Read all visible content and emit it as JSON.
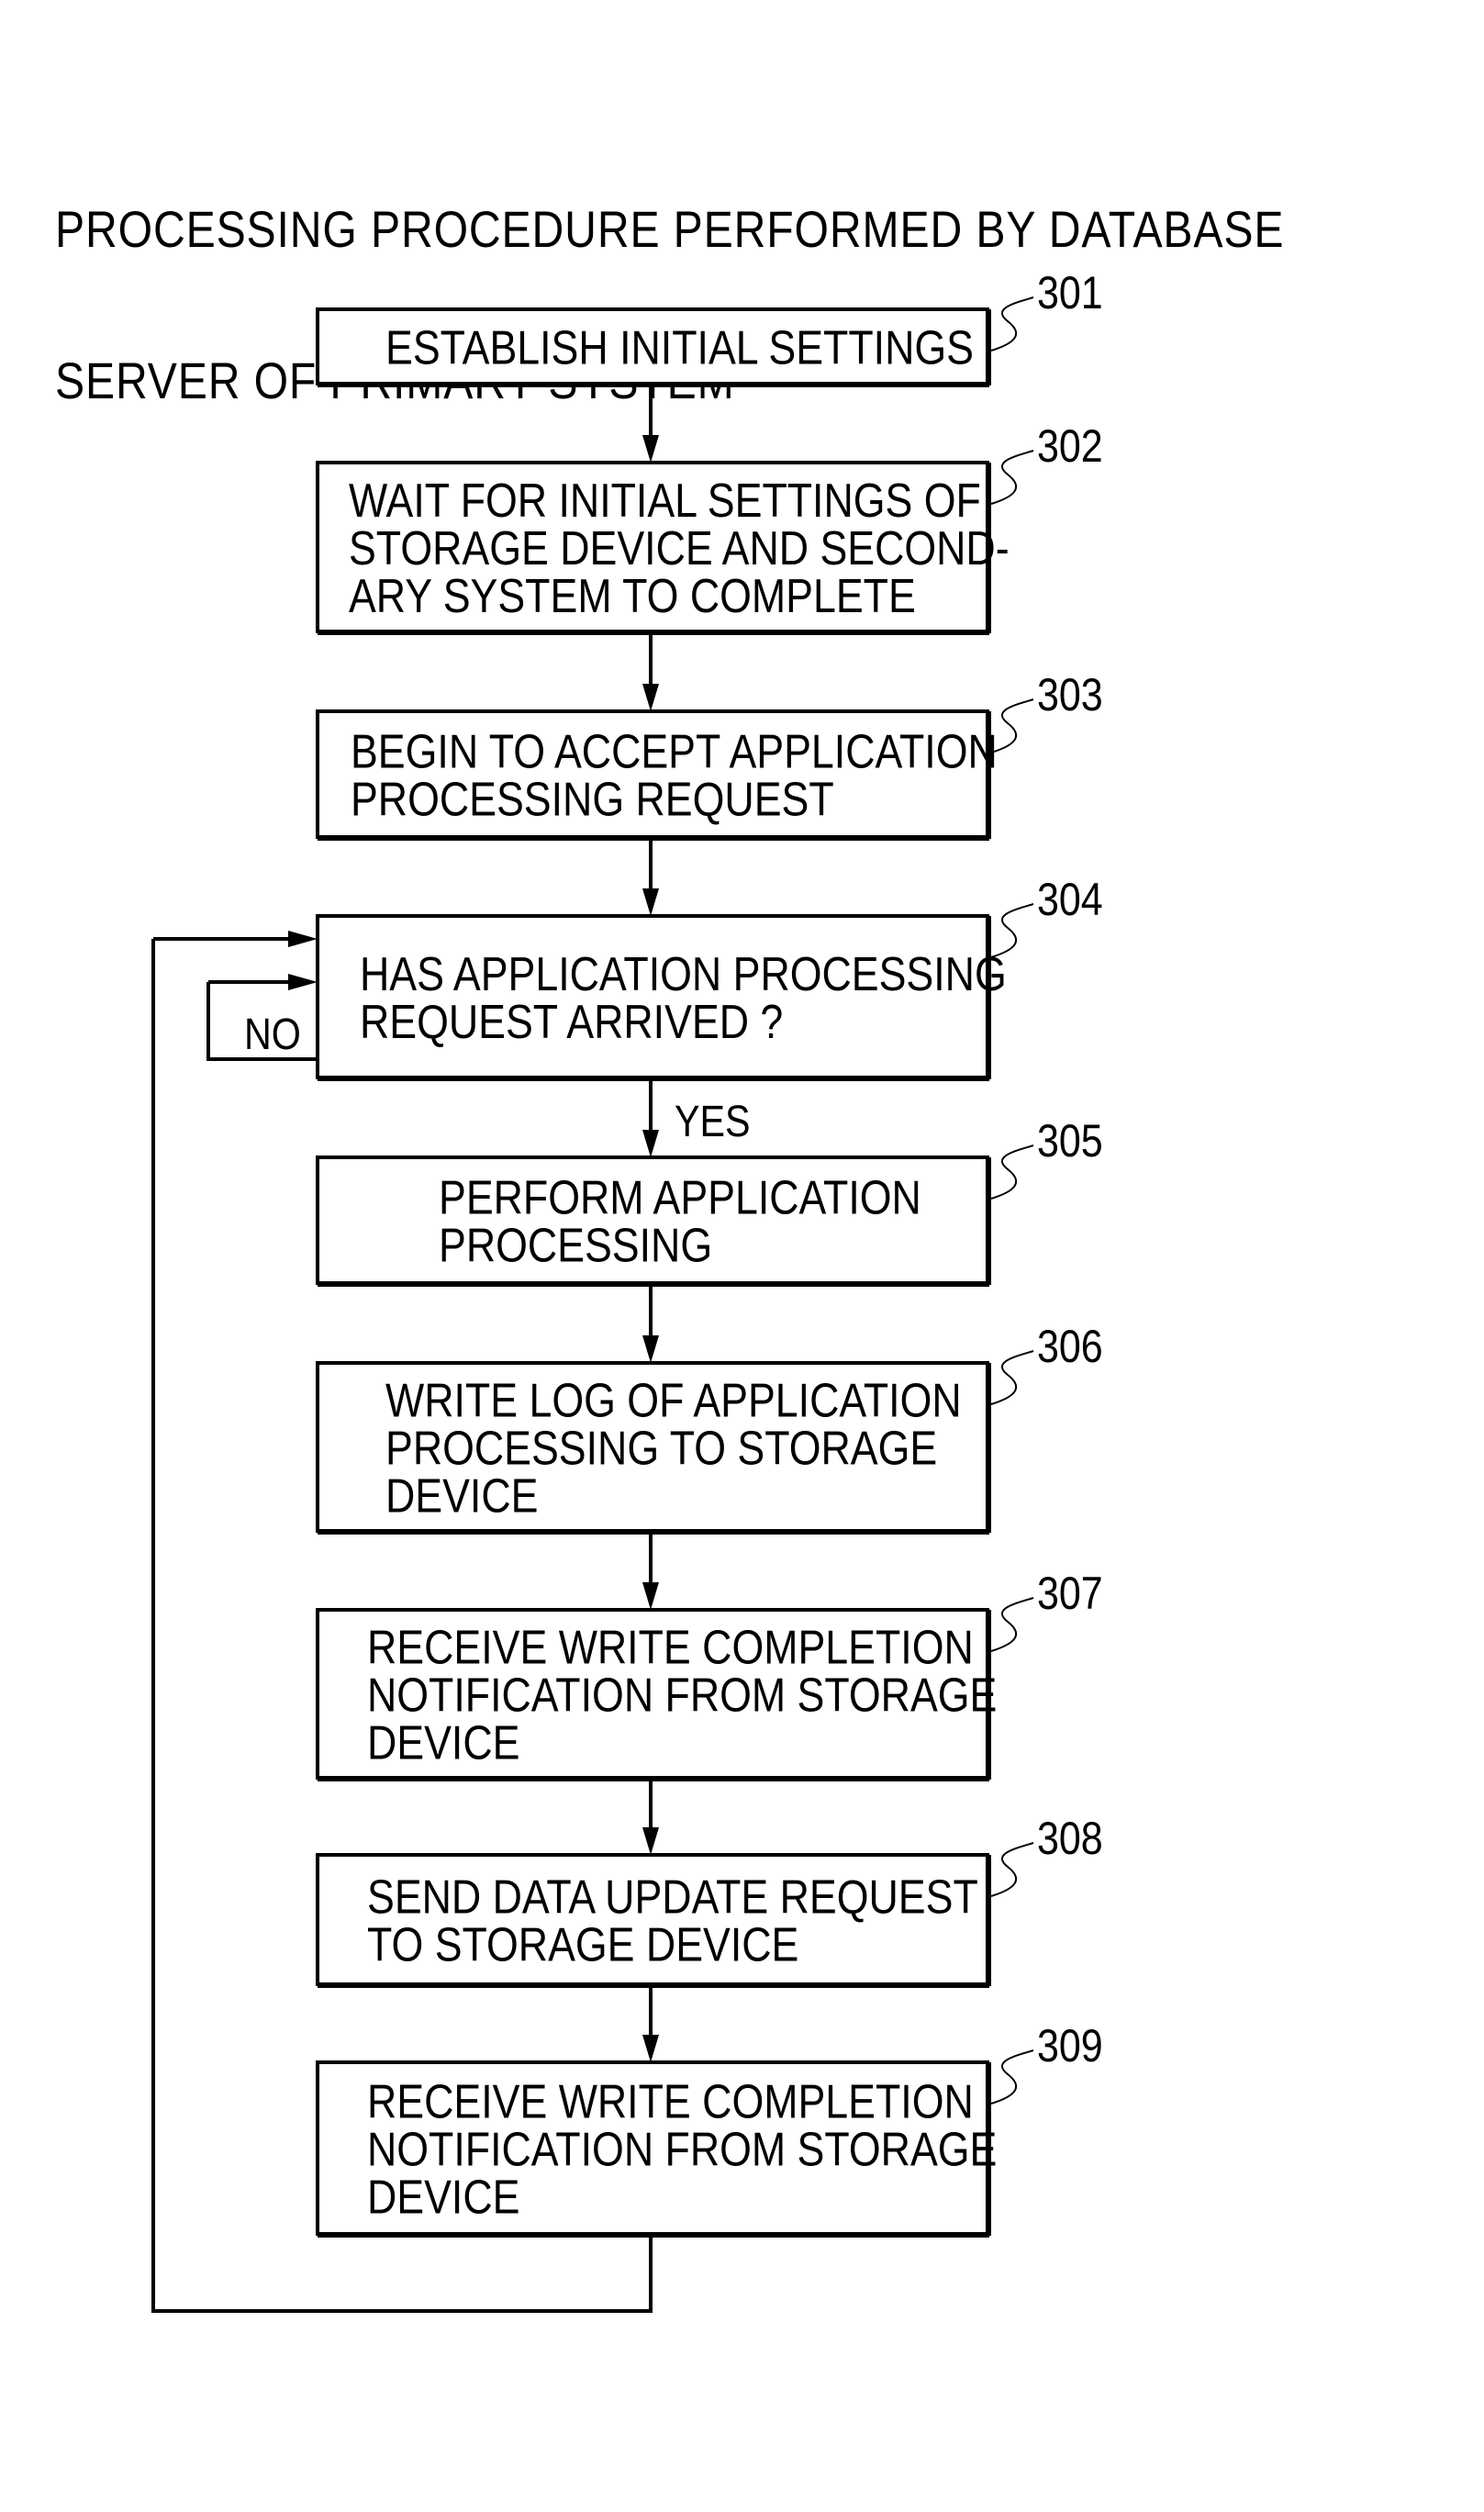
{
  "title": {
    "lines": [
      "PROCESSING PROCEDURE PERFORMED BY DATABASE",
      "SERVER OF PRIMARY SYSTEM"
    ]
  },
  "steps": [
    {
      "ref": "301",
      "type": "process",
      "lines": [
        "ESTABLISH INITIAL SETTINGS"
      ]
    },
    {
      "ref": "302",
      "type": "process",
      "lines": [
        "WAIT FOR INITIAL SETTINGS OF",
        "STORAGE DEVICE AND SECOND-",
        "ARY SYSTEM TO COMPLETE"
      ]
    },
    {
      "ref": "303",
      "type": "process",
      "lines": [
        "BEGIN TO ACCEPT APPLICATION",
        "PROCESSING REQUEST"
      ]
    },
    {
      "ref": "304",
      "type": "decision",
      "lines": [
        "HAS APPLICATION PROCESSING",
        "REQUEST ARRIVED ?"
      ]
    },
    {
      "ref": "305",
      "type": "process",
      "lines": [
        "PERFORM APPLICATION",
        "PROCESSING"
      ]
    },
    {
      "ref": "306",
      "type": "process",
      "lines": [
        "WRITE LOG OF APPLICATION",
        "PROCESSING TO STORAGE",
        "DEVICE"
      ]
    },
    {
      "ref": "307",
      "type": "process",
      "lines": [
        "RECEIVE WRITE COMPLETION",
        "NOTIFICATION FROM STORAGE",
        "DEVICE"
      ]
    },
    {
      "ref": "308",
      "type": "process",
      "lines": [
        "SEND DATA UPDATE REQUEST",
        "TO STORAGE DEVICE"
      ]
    },
    {
      "ref": "309",
      "type": "process",
      "lines": [
        "RECEIVE WRITE COMPLETION",
        "NOTIFICATION FROM STORAGE",
        "DEVICE"
      ]
    }
  ],
  "branches": {
    "yes_label": "YES",
    "no_label": "NO"
  },
  "edges": [
    {
      "from": "301",
      "to": "302"
    },
    {
      "from": "302",
      "to": "303"
    },
    {
      "from": "303",
      "to": "304"
    },
    {
      "from": "304",
      "to": "305",
      "label": "YES"
    },
    {
      "from": "304",
      "to": "304",
      "label": "NO"
    },
    {
      "from": "305",
      "to": "306"
    },
    {
      "from": "306",
      "to": "307"
    },
    {
      "from": "307",
      "to": "308"
    },
    {
      "from": "308",
      "to": "309"
    },
    {
      "from": "309",
      "to": "304"
    }
  ]
}
